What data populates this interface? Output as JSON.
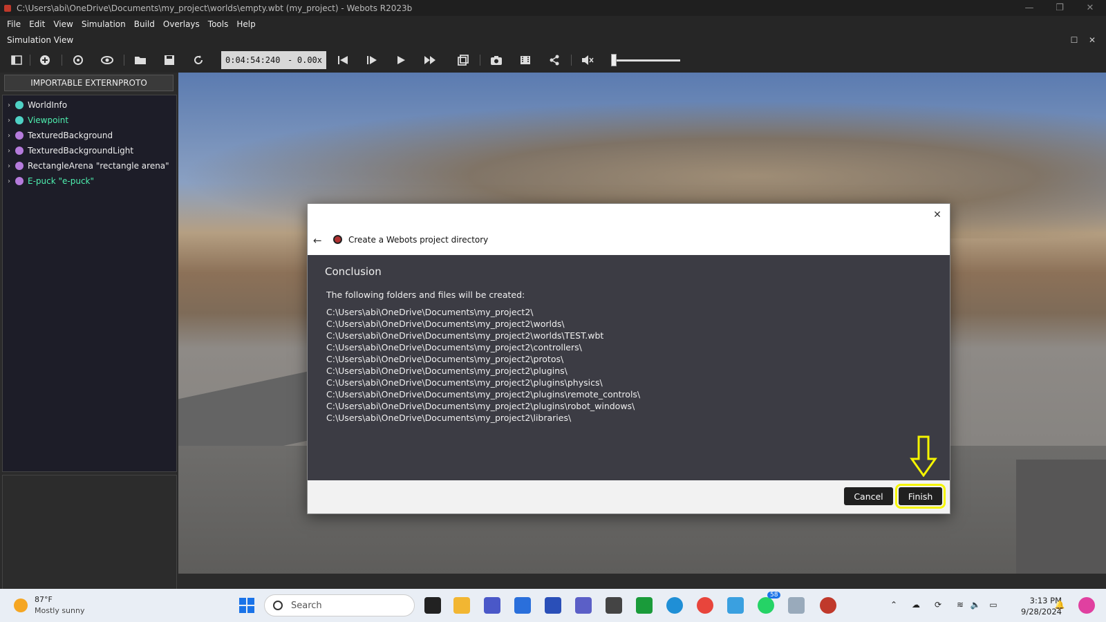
{
  "window": {
    "title": "C:\\Users\\abi\\OneDrive\\Documents\\my_project\\worlds\\empty.wbt (my_project) - Webots R2023b"
  },
  "menu": {
    "items": [
      "File",
      "Edit",
      "View",
      "Simulation",
      "Build",
      "Overlays",
      "Tools",
      "Help"
    ]
  },
  "panel": {
    "title": "Simulation View"
  },
  "toolbar": {
    "time": "0:04:54:240",
    "dash": "-",
    "speed": "0.00x",
    "volume_level": 0.02
  },
  "scene_tree": {
    "extern_button": "IMPORTABLE EXTERNPROTO",
    "items": [
      {
        "label": "WorldInfo",
        "dot": "#4fd1c5",
        "color": "#eeeeee"
      },
      {
        "label": "Viewpoint",
        "dot": "#4fd1c5",
        "color": "#4ef0b0"
      },
      {
        "label": "TexturedBackground",
        "dot": "#b57bdc",
        "color": "#eeeeee"
      },
      {
        "label": "TexturedBackgroundLight",
        "dot": "#b57bdc",
        "color": "#eeeeee"
      },
      {
        "label": "RectangleArena \"rectangle arena\"",
        "dot": "#b57bdc",
        "color": "#eeeeee"
      },
      {
        "label": "E-puck \"e-puck\"",
        "dot": "#b57bdc",
        "color": "#4ef0b0"
      }
    ]
  },
  "dialog": {
    "title": "Create a Webots project directory",
    "heading": "Conclusion",
    "intro": "The following folders and files will be created:",
    "paths": [
      "C:\\Users\\abi\\OneDrive\\Documents\\my_project2\\",
      "C:\\Users\\abi\\OneDrive\\Documents\\my_project2\\worlds\\",
      "C:\\Users\\abi\\OneDrive\\Documents\\my_project2\\worlds\\TEST.wbt",
      "C:\\Users\\abi\\OneDrive\\Documents\\my_project2\\controllers\\",
      "C:\\Users\\abi\\OneDrive\\Documents\\my_project2\\protos\\",
      "C:\\Users\\abi\\OneDrive\\Documents\\my_project2\\plugins\\",
      "C:\\Users\\abi\\OneDrive\\Documents\\my_project2\\plugins\\physics\\",
      "C:\\Users\\abi\\OneDrive\\Documents\\my_project2\\plugins\\remote_controls\\",
      "C:\\Users\\abi\\OneDrive\\Documents\\my_project2\\plugins\\robot_windows\\",
      "C:\\Users\\abi\\OneDrive\\Documents\\my_project2\\libraries\\"
    ],
    "cancel_label": "Cancel",
    "finish_label": "Finish",
    "highlight_color": "#f5f500"
  },
  "taskbar": {
    "weather_temp": "87°F",
    "weather_desc": "Mostly sunny",
    "search_placeholder": "Search",
    "whatsapp_badge": "58",
    "time": "3:13 PM",
    "date": "9/28/2024"
  }
}
